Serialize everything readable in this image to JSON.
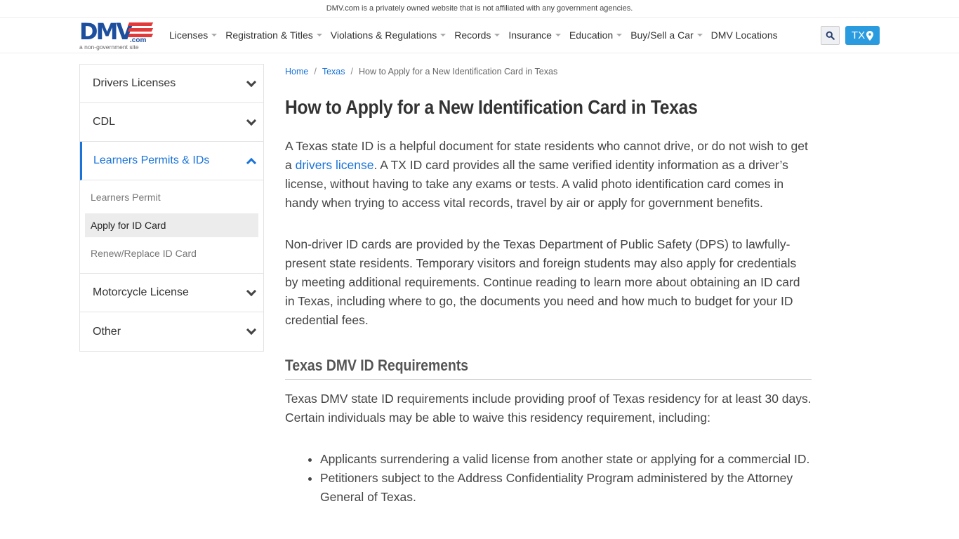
{
  "notice": "DMV.com is a privately owned website that is not affiliated with any government agencies.",
  "logo": {
    "word": "DMV",
    "com": ".com",
    "tagline": "a non-government site"
  },
  "nav": {
    "items": [
      {
        "label": "Licenses",
        "has_dropdown": true
      },
      {
        "label": "Registration & Titles",
        "has_dropdown": true
      },
      {
        "label": "Violations & Regulations",
        "has_dropdown": true
      },
      {
        "label": "Records",
        "has_dropdown": true
      },
      {
        "label": "Insurance",
        "has_dropdown": true
      },
      {
        "label": "Education",
        "has_dropdown": true
      },
      {
        "label": "Buy/Sell a Car",
        "has_dropdown": true
      },
      {
        "label": "DMV Locations",
        "has_dropdown": false
      }
    ],
    "search_icon": "search-icon",
    "state_label": "TX",
    "state_icon": "map-marker-icon"
  },
  "sidebar": {
    "sections": [
      {
        "label": "Drivers Licenses",
        "expanded": false
      },
      {
        "label": "CDL",
        "expanded": false
      },
      {
        "label": "Learners Permits & IDs",
        "expanded": true,
        "items": [
          {
            "label": "Learners Permit",
            "selected": false
          },
          {
            "label": "Apply for ID Card",
            "selected": true
          },
          {
            "label": "Renew/Replace ID Card",
            "selected": false
          }
        ]
      },
      {
        "label": "Motorcycle License",
        "expanded": false
      },
      {
        "label": "Other",
        "expanded": false
      }
    ]
  },
  "breadcrumb": {
    "home": "Home",
    "state": "Texas",
    "current": "How to Apply for a New Identification Card in Texas",
    "separator": "/"
  },
  "article": {
    "title": "How to Apply for a New Identification Card in Texas",
    "p1_before": "A Texas state ID is a helpful document for state residents who cannot drive, or do not wish to get a ",
    "p1_link": "drivers license",
    "p1_after": ". A TX ID card provides all the same verified identity information as a driver’s license, without having to take any exams or tests. A valid photo identification card comes in handy when trying to access vital records, travel by air or apply for government benefits.",
    "p2": "Non-driver ID cards are provided by the Texas Department of Public Safety (DPS) to lawfully-present state residents. Temporary visitors and foreign students may also apply for credentials by meeting additional requirements. Continue reading to learn more about obtaining an ID card in Texas, including where to go, the documents you need and how much to budget for your ID credential fees.",
    "h2": "Texas DMV ID Requirements",
    "p3": "Texas DMV state ID requirements include providing proof of Texas residency for at least 30 days. Certain individuals may be able to waive this residency requirement, including:",
    "list": [
      "Applicants surrendering a valid license from another state or applying for a commercial ID.",
      "Petitioners subject to the Address Confidentiality Program administered by the Attorney General of Texas."
    ]
  },
  "colors": {
    "brand_blue": "#1d4f9e",
    "brand_red": "#e23a3a",
    "link": "#1a73d9",
    "state_button": "#2b9be0"
  }
}
